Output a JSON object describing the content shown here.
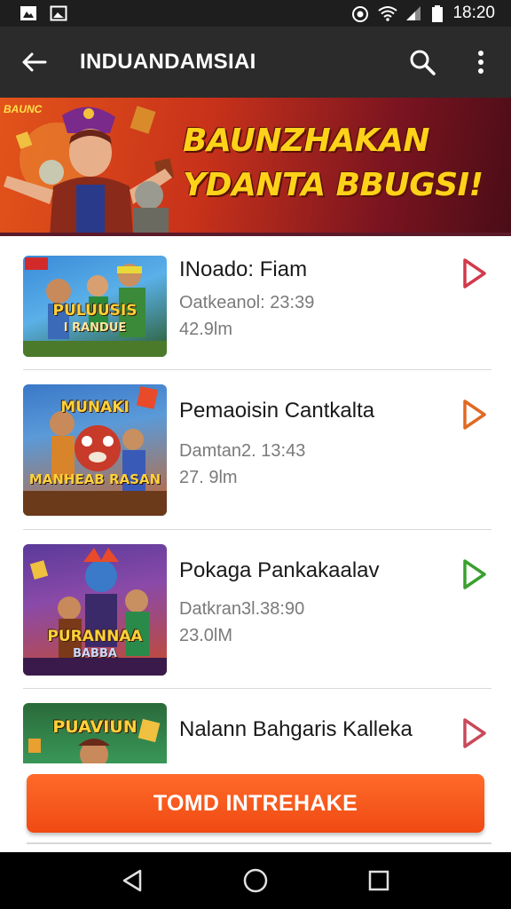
{
  "status_bar": {
    "time": "18:20",
    "icons": [
      "gallery-icon",
      "image-icon",
      "location-icon",
      "wifi-icon",
      "signal-icon",
      "battery-icon"
    ]
  },
  "app_bar": {
    "title": "INDUANDAMSIAI",
    "icons": [
      "back-arrow-icon",
      "search-icon",
      "more-vert-icon"
    ]
  },
  "banner": {
    "logo": "BAUNC",
    "line1": "BAUNZHAKAN",
    "line2": "YDANTA BBUGSI!"
  },
  "games": [
    {
      "title": "INoado: Fiam",
      "meta1": "Oatkeanol: 23:39",
      "meta2": "42.9lm",
      "thumb_title": "PULUUSIS",
      "thumb_sub": "I RANDUE",
      "play_color": "#d23a4c"
    },
    {
      "title": "Pemaoisin Cantkalta",
      "meta1": "Damtan2. 13:43",
      "meta2": "27. 9lm",
      "thumb_title": "MUNAKI",
      "thumb_sub": "MANHEAB RASAN",
      "play_color": "#e06a24"
    },
    {
      "title": "Pokaga Pankakaalav",
      "meta1": "Datkran3l.38:90",
      "meta2": "23.0lM",
      "thumb_title": "PURANNAA",
      "thumb_sub": "BABBA",
      "play_color": "#3aa030"
    },
    {
      "title": "Nalann Bahgaris Kalleka",
      "meta1": "",
      "meta2": "",
      "thumb_title": "PUAVIUN",
      "thumb_sub": "",
      "play_color": "#c84a5a"
    }
  ],
  "cta": {
    "label": "TOMD INTREHAKE",
    "color": "#f0531a"
  },
  "nav": {
    "icons": [
      "back-triangle-icon",
      "home-circle-icon",
      "recents-square-icon"
    ]
  }
}
